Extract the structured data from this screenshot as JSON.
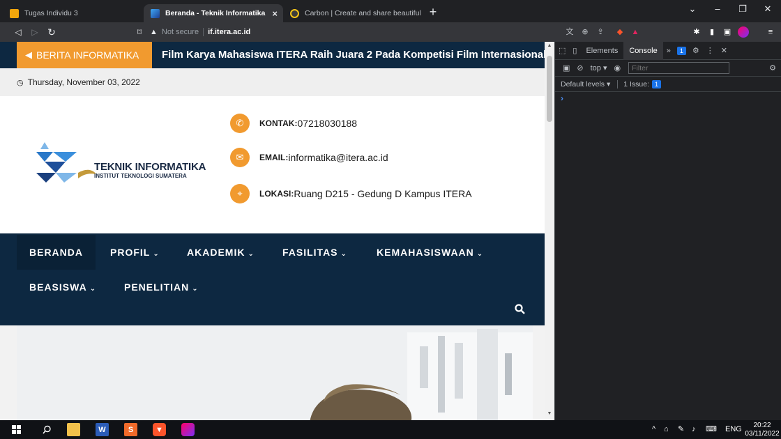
{
  "browser": {
    "tabs": [
      {
        "title": "Tugas Individu 3",
        "active": false
      },
      {
        "title": "Beranda - Teknik Informatika",
        "active": true
      },
      {
        "title": "Carbon | Create and share beautiful im",
        "active": false
      }
    ],
    "close_glyph": "×",
    "new_tab_glyph": "+",
    "window_controls": {
      "chevron": "⌄",
      "minimize": "–",
      "restore": "❐",
      "close": "✕"
    },
    "address": {
      "security_label": "Not secure",
      "host": "if.itera.ac.id"
    }
  },
  "site": {
    "ticker": {
      "label": "BERITA INFORMATIKA",
      "headline": "Film Karya Mahasiswa ITERA Raih Juara 2 Pada Kompetisi Film Internasional"
    },
    "date": "Thursday, November 03, 2022",
    "logo": {
      "name": "TEKNIK INFORMATIKA",
      "subtitle": "INSTITUT TEKNOLOGI SUMATERA"
    },
    "contacts": [
      {
        "label": "KONTAK:",
        "value": "07218030188",
        "icon": "phone-icon"
      },
      {
        "label": "EMAIL:",
        "value": "informatika@itera.ac.id",
        "icon": "mail-icon"
      },
      {
        "label": "LOKASI:",
        "value": "Ruang D215 - Gedung D Kampus ITERA",
        "icon": "location-pin-icon"
      }
    ],
    "nav": {
      "items": [
        {
          "label": "BERANDA",
          "dropdown": false
        },
        {
          "label": "PROFIL",
          "dropdown": true
        },
        {
          "label": "AKADEMIK",
          "dropdown": true
        },
        {
          "label": "FASILITAS",
          "dropdown": true
        },
        {
          "label": "KEMAHASISWAAN",
          "dropdown": true
        },
        {
          "label": "BEASISWA",
          "dropdown": true
        },
        {
          "label": "PENELITIAN",
          "dropdown": true
        }
      ],
      "chevron": "⌄"
    }
  },
  "devtools": {
    "tabs": {
      "elements": "Elements",
      "console": "Console"
    },
    "issue_badge": "1",
    "context": "top ▾",
    "filter_placeholder": "Filter",
    "levels": "Default levels ▾",
    "issues_label": "1 Issue:",
    "issues_count": "1",
    "prompt": "›"
  },
  "taskbar": {
    "language": "ENG",
    "time": "20:22",
    "date": "03/11/2022"
  },
  "colors": {
    "accent_orange": "#f19a2f",
    "navy": "#0d2841",
    "devtools_bg": "#202124"
  }
}
